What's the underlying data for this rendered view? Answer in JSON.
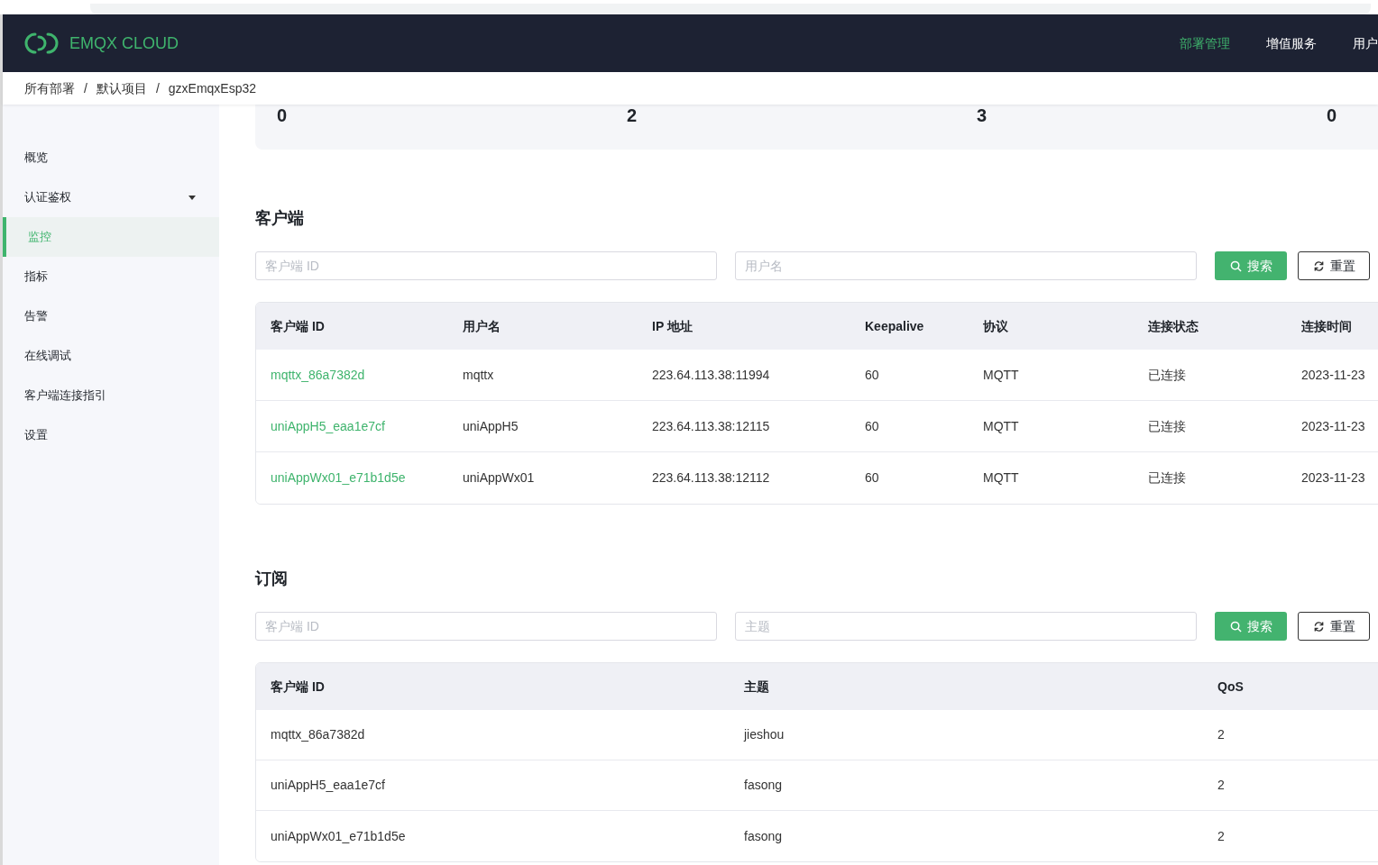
{
  "header": {
    "logo_text": "EMQX CLOUD",
    "nav": [
      {
        "label": "部署管理",
        "selected": true
      },
      {
        "label": "增值服务",
        "selected": false
      },
      {
        "label": "用户",
        "selected": false
      }
    ]
  },
  "breadcrumb": [
    {
      "kind": "link",
      "label": "所有部署"
    },
    {
      "kind": "separator",
      "label": "/"
    },
    {
      "kind": "link",
      "label": "默认项目"
    },
    {
      "kind": "separator",
      "label": "/"
    },
    {
      "kind": "link",
      "label": "gzxEmqxEsp32"
    }
  ],
  "sidebar": {
    "items": [
      {
        "label": "概览",
        "selected": false,
        "expandable": false
      },
      {
        "label": "认证鉴权",
        "selected": false,
        "expandable": true
      },
      {
        "label": "监控",
        "selected": true,
        "expandable": false
      },
      {
        "label": "指标",
        "selected": false,
        "expandable": false
      },
      {
        "label": "告警",
        "selected": false,
        "expandable": false
      },
      {
        "label": "在线调试",
        "selected": false,
        "expandable": false
      },
      {
        "label": "客户端连接指引",
        "selected": false,
        "expandable": false
      },
      {
        "label": "设置",
        "selected": false,
        "expandable": false
      }
    ]
  },
  "stats": [
    "0",
    "2",
    "3",
    "0"
  ],
  "clients": {
    "title": "客户端",
    "filters": [
      {
        "placeholder": "客户端 ID"
      },
      {
        "placeholder": "用户名"
      }
    ],
    "buttons": [
      {
        "kind": "search",
        "label": "搜索"
      },
      {
        "kind": "reset",
        "label": "重置"
      }
    ],
    "table": {
      "columns": [
        "客户端 ID",
        "用户名",
        "IP 地址",
        "Keepalive",
        "协议",
        "连接状态",
        "连接时间"
      ],
      "rows": [
        [
          "mqttx_86a7382d",
          "mqttx",
          "223.64.113.38:11994",
          "60",
          "MQTT",
          "已连接",
          "2023-11-23"
        ],
        [
          "uniAppH5_eaa1e7cf",
          "uniAppH5",
          "223.64.113.38:12115",
          "60",
          "MQTT",
          "已连接",
          "2023-11-23"
        ],
        [
          "uniAppWx01_e71b1d5e",
          "uniAppWx01",
          "223.64.113.38:12112",
          "60",
          "MQTT",
          "已连接",
          "2023-11-23"
        ]
      ]
    }
  },
  "subscriptions": {
    "title": "订阅",
    "filters": [
      {
        "placeholder": "客户端 ID"
      },
      {
        "placeholder": "主题"
      }
    ],
    "buttons": [
      {
        "kind": "search",
        "label": "搜索"
      },
      {
        "kind": "reset",
        "label": "重置"
      }
    ],
    "table": {
      "columns": [
        "客户端 ID",
        "主题",
        "QoS"
      ],
      "rows": [
        [
          "mqttx_86a7382d",
          "jieshou",
          "2"
        ],
        [
          "uniAppH5_eaa1e7cf",
          "fasong",
          "2"
        ],
        [
          "uniAppWx01_e71b1d5e",
          "fasong",
          "2"
        ]
      ]
    }
  }
}
